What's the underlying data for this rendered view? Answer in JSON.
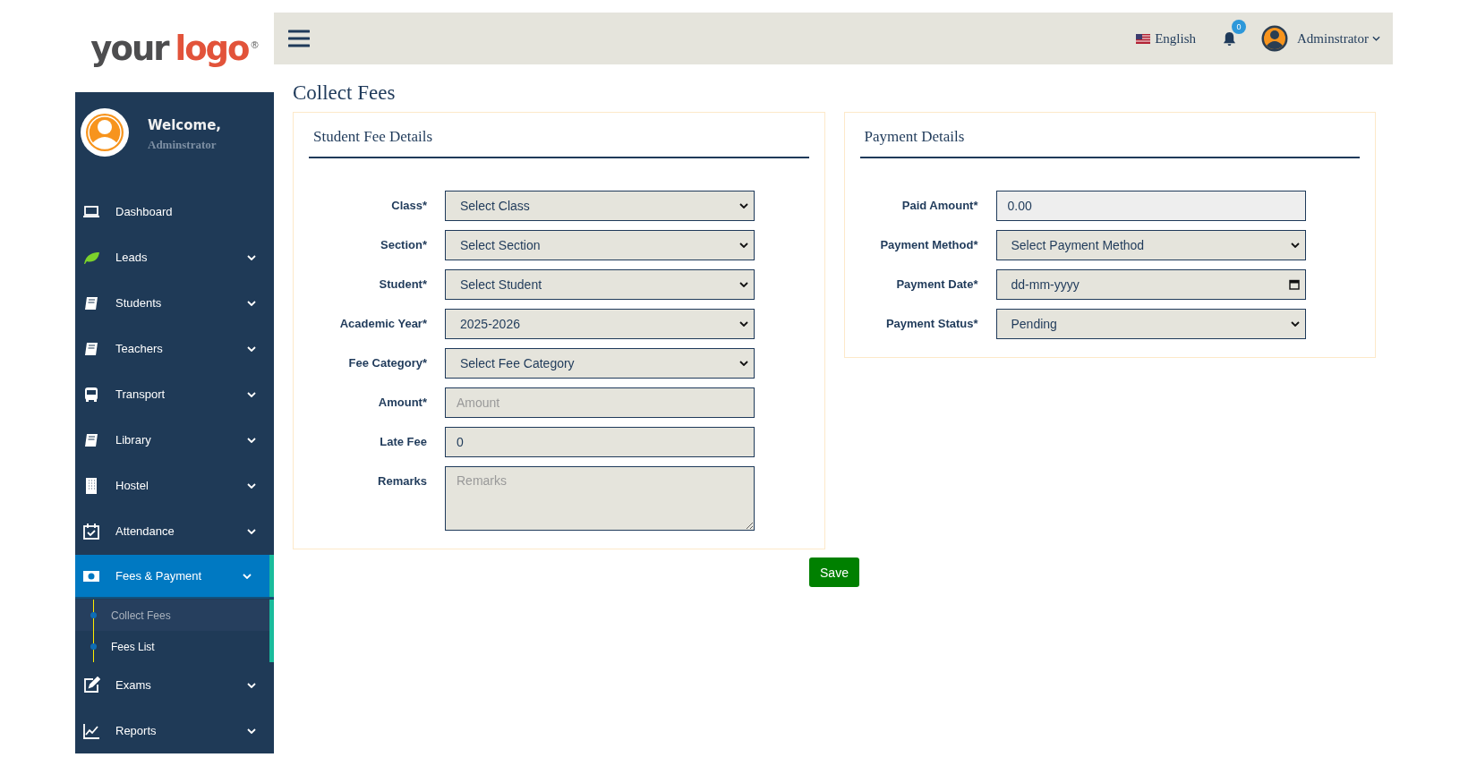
{
  "logo": {
    "first": "your",
    "second": "logo",
    "mark": "®"
  },
  "topbar": {
    "language": "English",
    "notifications": "0",
    "user": "Adminstrator"
  },
  "sidebar": {
    "welcome": "Welcome,",
    "user": "Adminstrator",
    "items": [
      {
        "kind": "laptop",
        "label": "Dashboard",
        "expandable": false,
        "selected": false
      },
      {
        "kind": "leaf",
        "label": "Leads",
        "expandable": true,
        "selected": false
      },
      {
        "kind": "book",
        "label": "Students",
        "expandable": true,
        "selected": false
      },
      {
        "kind": "book",
        "label": "Teachers",
        "expandable": true,
        "selected": false
      },
      {
        "kind": "bus",
        "label": "Transport",
        "expandable": true,
        "selected": false
      },
      {
        "kind": "book",
        "label": "Library",
        "expandable": true,
        "selected": false
      },
      {
        "kind": "building",
        "label": "Hostel",
        "expandable": true,
        "selected": false
      },
      {
        "kind": "calendar",
        "label": "Attendance",
        "expandable": true,
        "selected": false
      },
      {
        "kind": "money",
        "label": "Fees & Payment",
        "expandable": true,
        "expanded": true,
        "selected": true,
        "children": [
          {
            "label": "Collect Fees",
            "selected": true
          },
          {
            "label": "Fees List",
            "selected": false
          }
        ]
      },
      {
        "kind": "edit",
        "label": "Exams",
        "expandable": true,
        "selected": false
      },
      {
        "kind": "chart",
        "label": "Reports",
        "expandable": true,
        "selected": false
      }
    ]
  },
  "page": {
    "title": "Collect Fees"
  },
  "cards": [
    {
      "title": "Student Fee Details",
      "fields": [
        {
          "label": "Class*",
          "kind": "select",
          "value": "Select Class"
        },
        {
          "label": "Section*",
          "kind": "select",
          "value": "Select Section"
        },
        {
          "label": "Student*",
          "kind": "select",
          "value": "Select Student"
        },
        {
          "label": "Academic Year*",
          "kind": "select",
          "value": "2025-2026"
        },
        {
          "label": "Fee Category*",
          "kind": "select",
          "value": "Select Fee Category"
        },
        {
          "label": "Amount*",
          "kind": "input",
          "placeholder": "Amount"
        },
        {
          "label": "Late Fee",
          "kind": "input",
          "value": "0"
        },
        {
          "label": "Remarks",
          "kind": "textarea",
          "placeholder": "Remarks"
        }
      ]
    },
    {
      "title": "Payment Details",
      "fields": [
        {
          "label": "Paid Amount*",
          "kind": "input",
          "value": "0.00",
          "readonly": true
        },
        {
          "label": "Payment Method*",
          "kind": "select",
          "value": "Select Payment Method"
        },
        {
          "label": "Payment Date*",
          "kind": "date",
          "value": "dd-mm-yyyy"
        },
        {
          "label": "Payment Status*",
          "kind": "select",
          "value": "Pending"
        }
      ]
    }
  ],
  "save": "Save"
}
